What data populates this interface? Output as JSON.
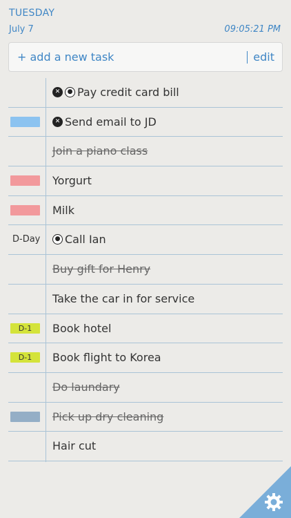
{
  "header": {
    "day": "TUESDAY",
    "date": "July 7",
    "time": "09:05:21 PM"
  },
  "addbar": {
    "label": "+ add a new task",
    "edit": "edit"
  },
  "tasks": [
    {
      "text": "Pay credit card bill",
      "tag": "",
      "tag_type": "",
      "done": false,
      "icons": [
        "pin-icon",
        "alarm-icon"
      ]
    },
    {
      "text": "Send email to JD",
      "tag": "",
      "tag_type": "blue",
      "done": false,
      "icons": [
        "pin-icon"
      ]
    },
    {
      "text": "Join a piano class",
      "tag": "",
      "tag_type": "",
      "done": true,
      "icons": []
    },
    {
      "text": "Yorgurt",
      "tag": "",
      "tag_type": "pink",
      "done": false,
      "icons": []
    },
    {
      "text": "Milk",
      "tag": "",
      "tag_type": "pink",
      "done": false,
      "icons": []
    },
    {
      "text": "Call Ian",
      "tag": "D-Day",
      "tag_type": "dday",
      "done": false,
      "icons": [
        "alarm-icon"
      ]
    },
    {
      "text": "Buy gift for Henry",
      "tag": "",
      "tag_type": "",
      "done": true,
      "icons": []
    },
    {
      "text": "Take the car in for service",
      "tag": "",
      "tag_type": "",
      "done": false,
      "icons": []
    },
    {
      "text": "Book hotel",
      "tag": "D-1",
      "tag_type": "lime",
      "done": false,
      "icons": []
    },
    {
      "text": "Book flight to Korea",
      "tag": "D-1",
      "tag_type": "lime",
      "done": false,
      "icons": []
    },
    {
      "text": "Do laundary",
      "tag": "",
      "tag_type": "",
      "done": true,
      "icons": []
    },
    {
      "text": "Pick up dry cleaning",
      "tag": "",
      "tag_type": "slate",
      "done": true,
      "icons": []
    },
    {
      "text": "Hair cut",
      "tag": "",
      "tag_type": "",
      "done": false,
      "icons": []
    }
  ],
  "colors": {
    "accent": "#3f86c5",
    "blue_tag": "#8cc3f0",
    "pink_tag": "#f2999c",
    "lime_tag": "#d4e33a",
    "slate_tag": "#94aec6",
    "corner": "#7aaed9"
  }
}
